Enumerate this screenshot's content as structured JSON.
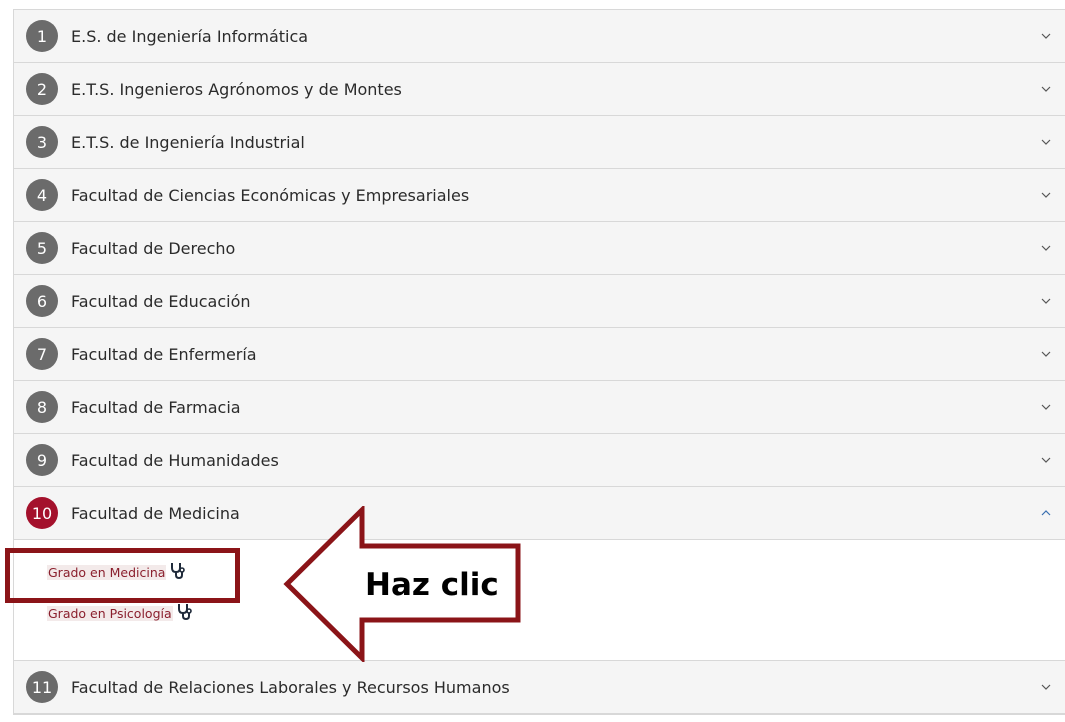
{
  "accordion": {
    "items": [
      {
        "number": "1",
        "label": "E.S. de Ingeniería Informática"
      },
      {
        "number": "2",
        "label": "E.T.S. Ingenieros Agrónomos y de Montes"
      },
      {
        "number": "3",
        "label": "E.T.S. de Ingeniería Industrial"
      },
      {
        "number": "4",
        "label": "Facultad de Ciencias Económicas y Empresariales"
      },
      {
        "number": "5",
        "label": "Facultad de Derecho"
      },
      {
        "number": "6",
        "label": "Facultad de Educación"
      },
      {
        "number": "7",
        "label": "Facultad de Enfermería"
      },
      {
        "number": "8",
        "label": "Facultad de Farmacia"
      },
      {
        "number": "9",
        "label": "Facultad de Humanidades"
      },
      {
        "number": "10",
        "label": "Facultad de Medicina"
      },
      {
        "number": "11",
        "label": "Facultad de Relaciones Laborales y Recursos Humanos"
      }
    ],
    "open_item": {
      "links": [
        {
          "label": "Grado en Medicina",
          "icon": "stethoscope-icon"
        },
        {
          "label": "Grado en Psicología",
          "icon": "stethoscope-icon"
        }
      ]
    }
  },
  "annotation": {
    "arrow_text": "Haz clic"
  },
  "colors": {
    "badge": "#6b6b6b",
    "badge_active": "#a4112c",
    "link": "#8a1f2d",
    "highlight": "#8b1418"
  }
}
